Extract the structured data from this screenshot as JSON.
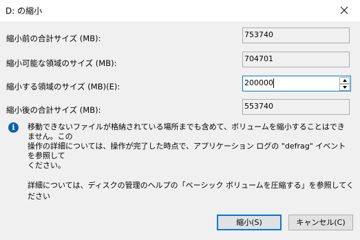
{
  "window": {
    "title": "D: の縮小"
  },
  "fields": {
    "total_before": {
      "label": "縮小前の合計サイズ (MB):",
      "value": "753740"
    },
    "available": {
      "label": "縮小可能な領域のサイズ (MB):",
      "value": "704701"
    },
    "shrink_amount": {
      "label": "縮小する領域のサイズ (MB)(E):",
      "value": "200000"
    },
    "total_after": {
      "label": "縮小後の合計サイズ (MB):",
      "value": "553740"
    }
  },
  "info": {
    "line1": "移動できないファイルが格納されている場所までも含めて、ボリュームを縮小することはできません。この",
    "line2": "操作の詳細については、操作が完了した時点で、アプリケーション ログの \"defrag\" イベントを参照して",
    "line3": "ください。"
  },
  "help": "詳細については、ディスクの管理のヘルプの「ベーシック ボリュームを圧縮する」を参照してください",
  "buttons": {
    "shrink": "縮小(S)",
    "cancel": "キャンセル(C)"
  },
  "icons": {
    "close": "close-icon",
    "info": "info-icon",
    "spin_up": "chevron-up-icon",
    "spin_down": "chevron-down-icon"
  },
  "colors": {
    "accent": "#0078d7",
    "panel": "#f0f0f0",
    "info_icon": "#0a5fb3"
  }
}
